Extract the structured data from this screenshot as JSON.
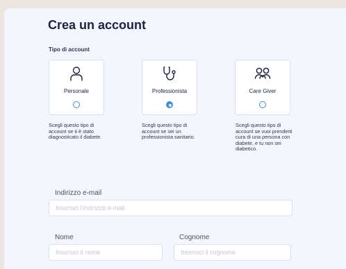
{
  "form": {
    "title": "Crea un account",
    "account_type_label": "Tipo di account",
    "account_types": [
      {
        "label": "Personale",
        "icon": "person-icon",
        "selected": false,
        "description": "Scegli questo tipo di account se ti è stato diagnosticato il diabete."
      },
      {
        "label": "Professionista",
        "icon": "stethoscope-icon",
        "selected": true,
        "description": "Scegli questo tipo di account se sei un professionista sanitario."
      },
      {
        "label": "Care Giver",
        "icon": "group-icon",
        "selected": false,
        "description": "Scegli questo tipo di account se vuoi prenderti cura di una persona con diabete, e tu non sei diabetico."
      }
    ],
    "email": {
      "label": "Indirizzo e-mail",
      "placeholder": "Inserisci l'indirizzo e-mail",
      "value": ""
    },
    "first_name": {
      "label": "Nome",
      "placeholder": "Inserisci il nome",
      "value": ""
    },
    "last_name": {
      "label": "Cognome",
      "placeholder": "Inserisci il cognome",
      "value": ""
    }
  },
  "colors": {
    "background": "#ebe6df",
    "card": "#f3f6fd",
    "accent": "#3c8ed6",
    "text": "#1b2340"
  }
}
